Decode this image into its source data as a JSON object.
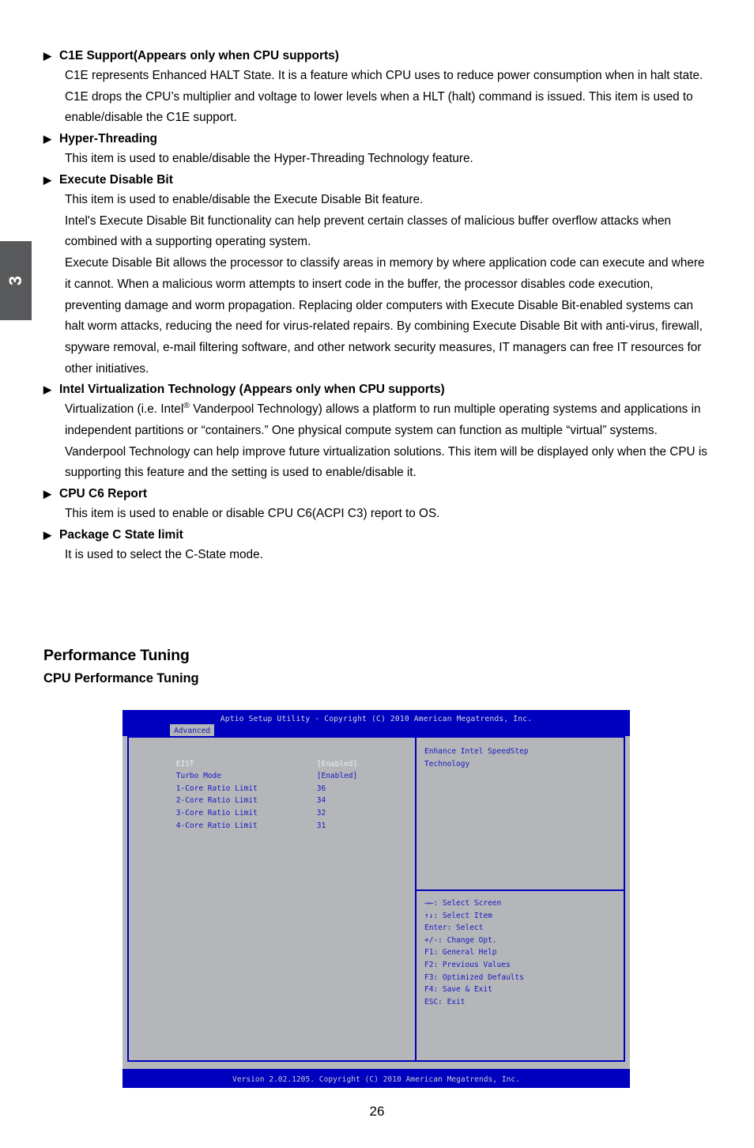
{
  "chapter_tab": {
    "number": "3"
  },
  "page_number": "26",
  "bullet_glyph": "▶",
  "items": [
    {
      "title": "C1E Support(Appears only when CPU supports)",
      "paragraphs": [
        "C1E represents Enhanced HALT State. It is a feature which CPU uses to reduce power consumption when in halt state. C1E drops the CPU’s multiplier and voltage to lower levels when a HLT (halt) command is issued. This item is used to enable/disable the C1E support."
      ]
    },
    {
      "title": "Hyper-Threading",
      "paragraphs": [
        "This item is used to enable/disable the Hyper-Threading Technology feature."
      ]
    },
    {
      "title": "Execute Disable Bit",
      "paragraphs": [
        "This item is used to enable/disable the Execute Disable Bit feature.",
        "Intel's Execute Disable Bit functionality can help prevent certain classes of malicious buffer overflow attacks when combined with a supporting operating system.",
        "Execute Disable Bit allows the processor to classify areas in memory by where application code can execute and where it cannot. When a malicious worm attempts to insert code in the buffer, the processor disables code execution, preventing damage and worm propagation. Replacing older computers with Execute Disable Bit-enabled systems can halt worm attacks, reducing the need for virus-related repairs. By combining Execute Disable Bit with anti-virus, firewall, spyware removal, e-mail filtering software, and other network security measures, IT managers can free IT resources for other initiatives."
      ]
    },
    {
      "title": "Intel Virtualization Technology  (Appears only when CPU supports)",
      "paragraphs_rich": [
        {
          "before": "Virtualization (i.e. Intel",
          "sup": "®",
          "after": " Vanderpool Technology) allows a platform to run multiple operating systems and applications in independent partitions or “containers.” One physical compute system can function as multiple “virtual” systems. Vanderpool Technology can help improve future virtualization solutions. This item will be displayed only when the CPU is supporting this feature and the setting is used to enable/disable it."
        }
      ]
    },
    {
      "title": "CPU C6 Report",
      "paragraphs": [
        "This item is used to enable or disable CPU C6(ACPI C3) report to OS."
      ]
    },
    {
      "title": "Package C State limit",
      "paragraphs": [
        "It is used to select the C-State mode."
      ]
    }
  ],
  "headings": {
    "major": "Performance Tuning",
    "minor": "CPU Performance Tuning"
  },
  "bios": {
    "title": "Aptio Setup Utility - Copyright (C) 2010 American Megatrends, Inc.",
    "active_tab": "Advanced",
    "settings": [
      {
        "label": "EIST",
        "value": "[Enabled]",
        "selected": true
      },
      {
        "label": "Turbo Mode",
        "value": "[Enabled]",
        "selected": false
      },
      {
        "label": "1-Core Ratio Limit",
        "value": "36",
        "selected": false
      },
      {
        "label": "2-Core Ratio Limit",
        "value": "34",
        "selected": false
      },
      {
        "label": "3-Core Ratio Limit",
        "value": "32",
        "selected": false
      },
      {
        "label": "4-Core Ratio Limit",
        "value": "31",
        "selected": false
      }
    ],
    "help_lines": [
      "Enhance Intel SpeedStep",
      "Technology"
    ],
    "key_legend": [
      "→←: Select Screen",
      "↑↓: Select Item",
      "Enter: Select",
      "+/-: Change Opt.",
      "F1: General Help",
      "F2: Previous Values",
      "F3: Optimized Defaults",
      "F4: Save & Exit",
      "ESC: Exit"
    ],
    "footer": "Version 2.02.1205. Copyright (C) 2010 American Megatrends, Inc.",
    "colors": {
      "bar_blue": "#0000bf",
      "panel_gray": "#b4b6ba",
      "text_blue": "#1818c0",
      "text_highlight": "#edeef0"
    }
  }
}
